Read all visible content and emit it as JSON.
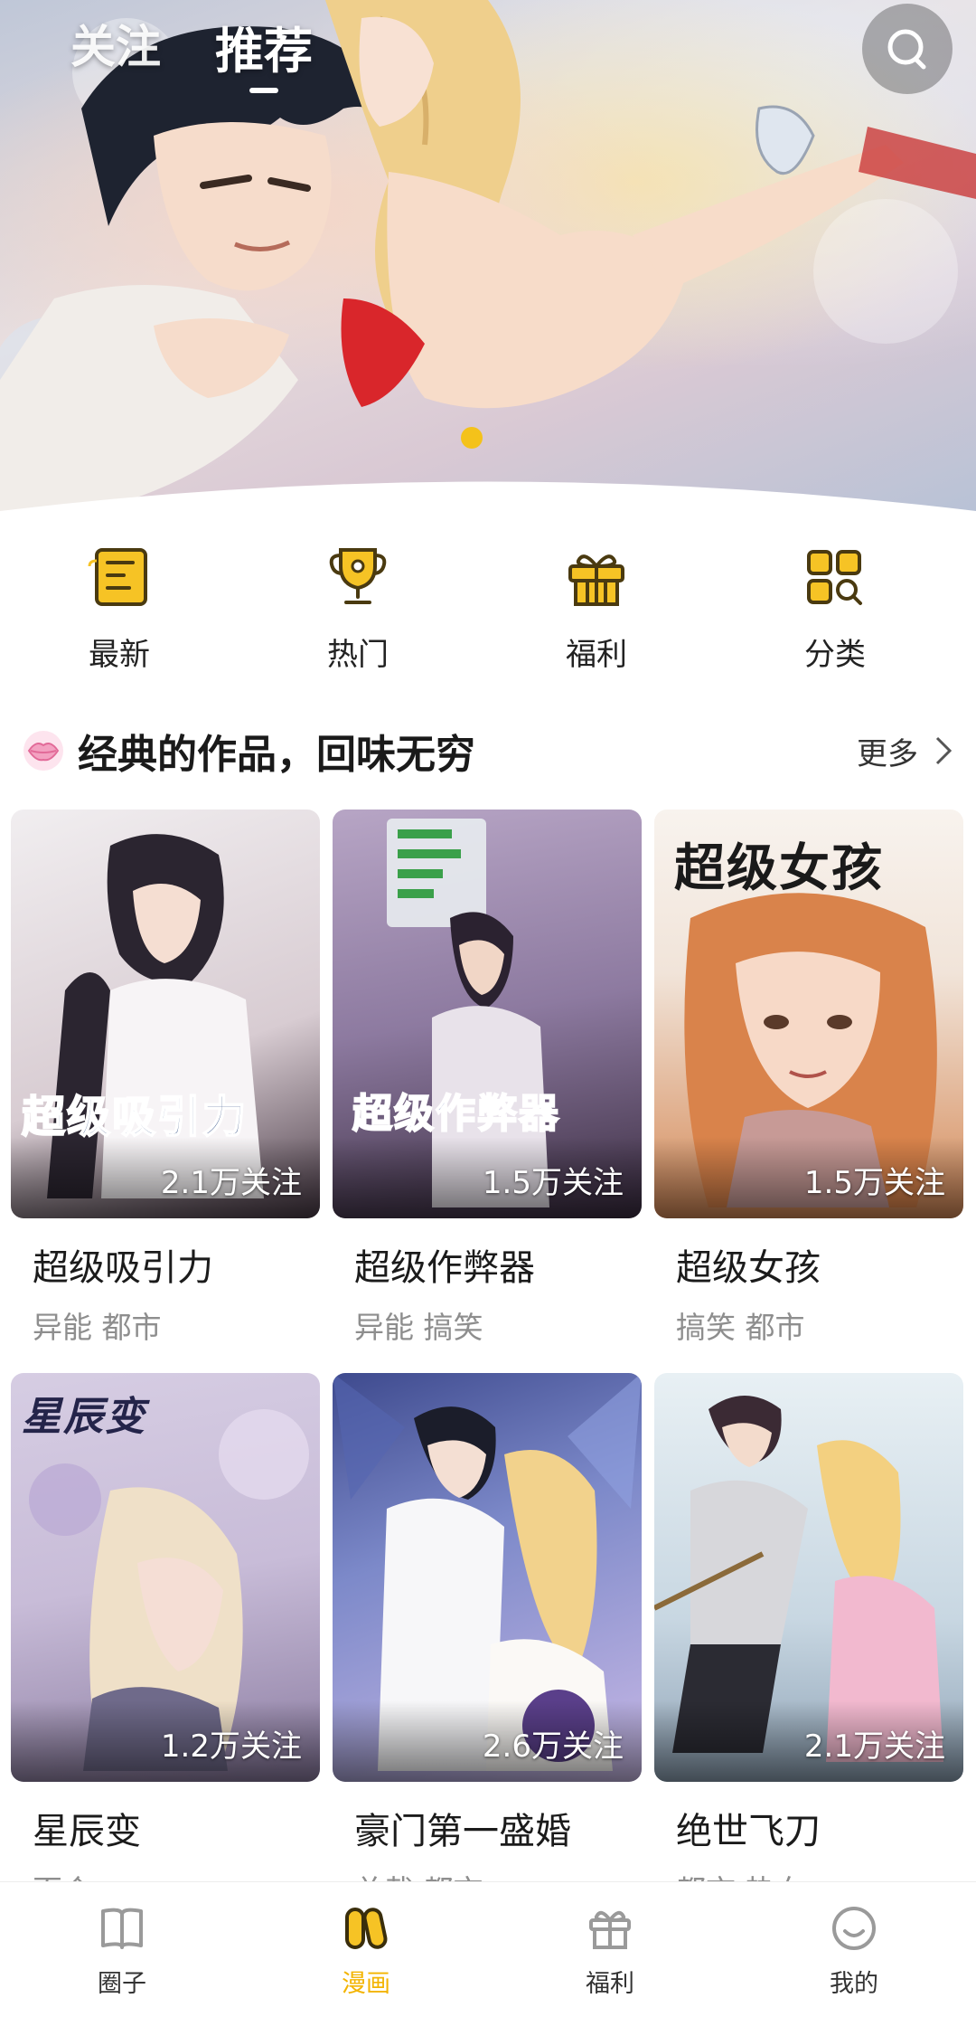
{
  "header": {
    "tabs": [
      {
        "label": "关注",
        "active": false
      },
      {
        "label": "推荐",
        "active": true
      }
    ],
    "search_icon": "search-icon"
  },
  "quick_nav": [
    {
      "label": "最新",
      "icon": "news-icon"
    },
    {
      "label": "热门",
      "icon": "trophy-icon"
    },
    {
      "label": "福利",
      "icon": "gift-icon"
    },
    {
      "label": "分类",
      "icon": "category-icon"
    }
  ],
  "section": {
    "title": "经典的作品，回味无穷",
    "more_label": "更多",
    "icon": "lips-icon"
  },
  "comics": [
    {
      "name": "超级吸引力",
      "tags": "异能 都市",
      "follows": "2.1万关注",
      "cover_text": "超级吸引力",
      "palette": [
        "#e9e4e6",
        "#b9a9b1",
        "#3a2f3c"
      ]
    },
    {
      "name": "超级作弊器",
      "tags": "异能 搞笑",
      "follows": "1.5万关注",
      "cover_text": "超级作弊器",
      "palette": [
        "#c9b3cf",
        "#8f7aa0",
        "#3b2d3f"
      ]
    },
    {
      "name": "超级女孩",
      "tags": "搞笑 都市",
      "follows": "1.5万关注",
      "cover_text": "超级女孩",
      "palette": [
        "#f4ece4",
        "#e39a63",
        "#7a3c26"
      ]
    },
    {
      "name": "星辰变",
      "tags": "百合",
      "follows": "1.2万关注",
      "cover_text": "星辰变",
      "palette": [
        "#d7cfe4",
        "#c4b6d6",
        "#8b7aa3"
      ]
    },
    {
      "name": "豪门第一盛婚",
      "tags": "总裁 都市",
      "follows": "2.6万关注",
      "cover_text": "",
      "palette": [
        "#5b6aa8",
        "#9aa6d8",
        "#f1e6d2"
      ]
    },
    {
      "name": "绝世飞刀",
      "tags": "都市 热血",
      "follows": "2.1万关注",
      "cover_text": "",
      "palette": [
        "#dbe6ee",
        "#f3d3e1",
        "#4a3b44"
      ]
    }
  ],
  "bottom_nav": [
    {
      "label": "圈子",
      "icon": "book-icon",
      "active": false
    },
    {
      "label": "漫画",
      "icon": "comic-icon",
      "active": true
    },
    {
      "label": "福利",
      "icon": "gift-icon",
      "active": false
    },
    {
      "label": "我的",
      "icon": "smile-icon",
      "active": false
    }
  ],
  "colors": {
    "accent": "#f3b400",
    "icon_yellow": "#f6c325",
    "icon_dark": "#4a3a10",
    "banner_dot": "#f4c21a"
  }
}
